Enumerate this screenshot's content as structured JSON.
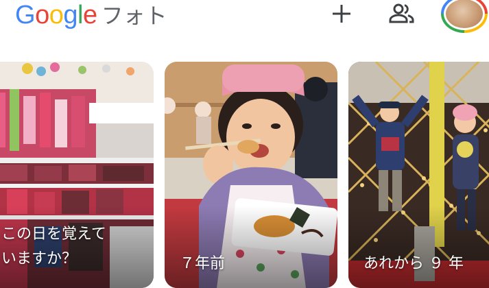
{
  "header": {
    "logo_text": "Google",
    "app_name": "フォト",
    "logo_colors": [
      "#4285f4",
      "#ea4335",
      "#fbbc05",
      "#4285f4",
      "#34a853",
      "#ea4335"
    ],
    "add_icon": "plus-icon",
    "sharing_icon": "people-icon",
    "account_icon": "account-avatar"
  },
  "memories": [
    {
      "caption_line1": "この日を覚えて",
      "caption_line2": "いますか？"
    },
    {
      "caption": "７年前"
    },
    {
      "caption": "あれから ９ 年"
    }
  ]
}
